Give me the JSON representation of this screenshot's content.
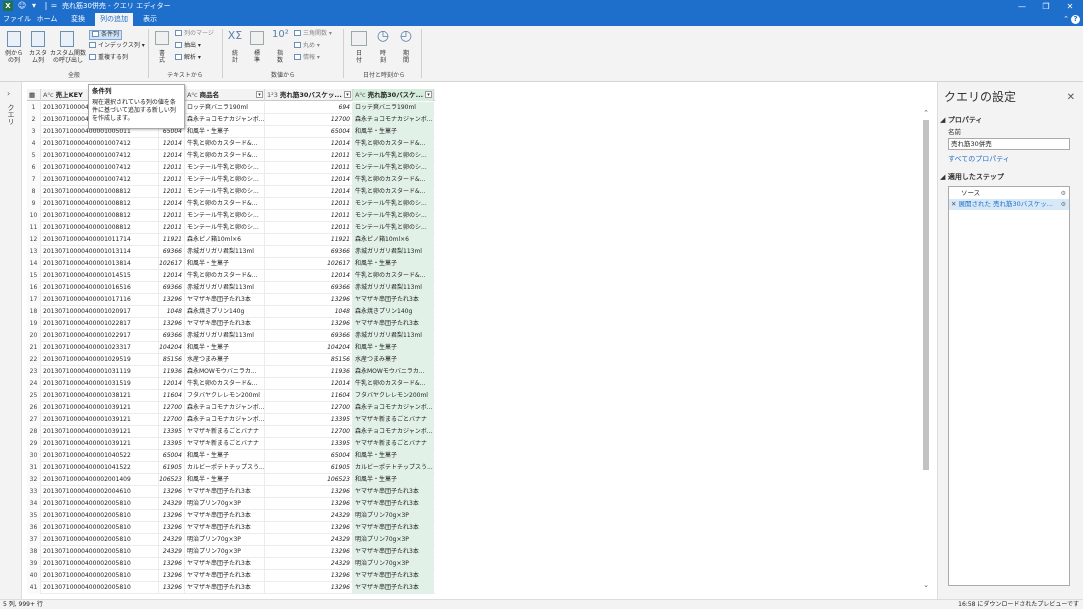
{
  "titlebar": {
    "app_letter": "X",
    "title": "売れ筋30併売 - クエリ エディター",
    "controls": {
      "minimize": "—",
      "maximize": "❐",
      "close": "✕"
    }
  },
  "tabs": [
    {
      "label": "ファイル"
    },
    {
      "label": "ホーム"
    },
    {
      "label": "変換"
    },
    {
      "label": "列の追加"
    },
    {
      "label": "表示"
    }
  ],
  "ribbon": {
    "btn_example": [
      "例から",
      "の列"
    ],
    "btn_custom": [
      "カスタ",
      "ム列"
    ],
    "btn_invoke": [
      "カスタム関数",
      "の呼び出し"
    ],
    "btn_conditional": "条件列",
    "btn_index": "インデックス列",
    "btn_duplicate": "重複する列",
    "group_general": "全般",
    "btn_format": [
      "書",
      "式"
    ],
    "btn_merge": "列のマージ",
    "btn_extract": "抽出",
    "btn_parse": "解析",
    "group_text": "テキストから",
    "btn_stats": [
      "統",
      "計"
    ],
    "btn_standard": [
      "標",
      "準"
    ],
    "btn_scientific": [
      "指",
      "数"
    ],
    "btn_trig": "三角関数",
    "btn_round": "丸め",
    "btn_info": "情報",
    "group_number": "数値から",
    "btn_date": [
      "日",
      "付"
    ],
    "btn_time": [
      "時",
      "刻"
    ],
    "btn_duration": [
      "期",
      "間"
    ],
    "group_datetime": "日付と時刻から"
  },
  "leftpanel": {
    "label": "クエリ"
  },
  "tooltip": {
    "title": "条件列",
    "body": "現在選択されている列の値を条件に基づいて追加する新しい列を作成します。"
  },
  "grid": {
    "headers": [
      {
        "type": "A⁰c",
        "label": "売上KEY"
      },
      {
        "type": "",
        "label": ""
      },
      {
        "type": "A⁰c",
        "label": "商品名"
      },
      {
        "type": "1²3",
        "label": "売れ筋30バスケッ..."
      },
      {
        "type": "A⁰c",
        "label": "売れ筋30バスケ..."
      }
    ],
    "rows": [
      [
        "1",
        "20130710000400001000",
        "694",
        "ロッテ爽バニラ190ml",
        "694",
        "ロッテ爽バニラ190ml"
      ],
      [
        "2",
        "20130710000400001000",
        "12700",
        "森永チョコモナカジャンボ...",
        "12700",
        "森永チョコモナカジャンボ..."
      ],
      [
        "3",
        "20130710000400001005011",
        "65004",
        "和風半・生菓子",
        "65004",
        "和風半・生菓子"
      ],
      [
        "4",
        "20130710000400001007412",
        "12014",
        "牛乳と卵のカスタード&...",
        "12014",
        "牛乳と卵のカスタード&..."
      ],
      [
        "5",
        "20130710000400001007412",
        "12014",
        "牛乳と卵のカスタード&...",
        "12011",
        "モンテール牛乳と卵のシ..."
      ],
      [
        "6",
        "20130710000400001007412",
        "12011",
        "モンテール牛乳と卵のシ...",
        "12011",
        "モンテール牛乳と卵のシ..."
      ],
      [
        "7",
        "20130710000400001007412",
        "12011",
        "モンテール牛乳と卵のシ...",
        "12014",
        "牛乳と卵のカスタード&..."
      ],
      [
        "8",
        "20130710000400001008812",
        "12011",
        "モンテール牛乳と卵のシ...",
        "12014",
        "牛乳と卵のカスタード&..."
      ],
      [
        "9",
        "20130710000400001008812",
        "12014",
        "牛乳と卵のカスタード&...",
        "12011",
        "モンテール牛乳と卵のシ..."
      ],
      [
        "10",
        "20130710000400001008812",
        "12011",
        "モンテール牛乳と卵のシ...",
        "12011",
        "モンテール牛乳と卵のシ..."
      ],
      [
        "11",
        "20130710000400001008812",
        "12011",
        "モンテール牛乳と卵のシ...",
        "12011",
        "モンテール牛乳と卵のシ..."
      ],
      [
        "12",
        "20130710000400001011714",
        "11921",
        "森永ピノ箱10ml×6",
        "11921",
        "森永ピノ箱10ml×6"
      ],
      [
        "13",
        "20130710000400001013114",
        "69366",
        "赤城ガリガリ君梨113ml",
        "69366",
        "赤城ガリガリ君梨113ml"
      ],
      [
        "14",
        "20130710000400001013814",
        "102617",
        "和風半・生菓子",
        "102617",
        "和風半・生菓子"
      ],
      [
        "15",
        "20130710000400001014515",
        "12014",
        "牛乳と卵のカスタード&...",
        "12014",
        "牛乳と卵のカスタード&..."
      ],
      [
        "16",
        "20130710000400001016516",
        "69366",
        "赤城ガリガリ君梨113ml",
        "69366",
        "赤城ガリガリ君梨113ml"
      ],
      [
        "17",
        "20130710000400001017116",
        "13296",
        "ヤマザキ串団子たれ3本",
        "13296",
        "ヤマザキ串団子たれ3本"
      ],
      [
        "18",
        "20130710000400001020917",
        "1048",
        "森永焼きプリン140g",
        "1048",
        "森永焼きプリン140g"
      ],
      [
        "19",
        "20130710000400001022817",
        "13296",
        "ヤマザキ串団子たれ3本",
        "13296",
        "ヤマザキ串団子たれ3本"
      ],
      [
        "20",
        "20130710000400001022917",
        "69366",
        "赤城ガリガリ君梨113ml",
        "69366",
        "赤城ガリガリ君梨113ml"
      ],
      [
        "21",
        "20130710000400001023317",
        "104204",
        "和風半・生菓子",
        "104204",
        "和風半・生菓子"
      ],
      [
        "22",
        "20130710000400001029519",
        "85156",
        "水産つまみ菓子",
        "85156",
        "水産つまみ菓子"
      ],
      [
        "23",
        "20130710000400001031119",
        "11936",
        "森永MOWモウバニラカ...",
        "11936",
        "森永MOWモウバニラカ..."
      ],
      [
        "24",
        "20130710000400001031519",
        "12014",
        "牛乳と卵のカスタード&...",
        "12014",
        "牛乳と卵のカスタード&..."
      ],
      [
        "25",
        "20130710000400001038121",
        "11604",
        "フタバヤクレレモン200ml",
        "11604",
        "フタバヤクレレモン200ml"
      ],
      [
        "26",
        "20130710000400001039121",
        "12700",
        "森永チョコモナカジャンボ...",
        "12700",
        "森永チョコモナカジャンボ..."
      ],
      [
        "27",
        "20130710000400001039121",
        "12700",
        "森永チョコモナカジャンボ...",
        "13395",
        "ヤマザキ新まるごとバナナ"
      ],
      [
        "28",
        "20130710000400001039121",
        "13395",
        "ヤマザキ新まるごとバナナ",
        "12700",
        "森永チョコモナカジャンボ..."
      ],
      [
        "29",
        "20130710000400001039121",
        "13395",
        "ヤマザキ新まるごとバナナ",
        "13395",
        "ヤマザキ新まるごとバナナ"
      ],
      [
        "30",
        "20130710000400001040522",
        "65004",
        "和風半・生菓子",
        "65004",
        "和風半・生菓子"
      ],
      [
        "31",
        "20130710000400001041522",
        "61905",
        "カルビーポテトチップスう...",
        "61905",
        "カルビーポテトチップスう..."
      ],
      [
        "32",
        "20130710000400002001409",
        "106523",
        "和風半・生菓子",
        "106523",
        "和風半・生菓子"
      ],
      [
        "33",
        "20130710000400002004610",
        "13296",
        "ヤマザキ串団子たれ3本",
        "13296",
        "ヤマザキ串団子たれ3本"
      ],
      [
        "34",
        "20130710000400002005810",
        "24329",
        "明治プリン70g×3P",
        "13296",
        "ヤマザキ串団子たれ3本"
      ],
      [
        "35",
        "20130710000400002005810",
        "13296",
        "ヤマザキ串団子たれ3本",
        "24329",
        "明治プリン70g×3P"
      ],
      [
        "36",
        "20130710000400002005810",
        "13296",
        "ヤマザキ串団子たれ3本",
        "13296",
        "ヤマザキ串団子たれ3本"
      ],
      [
        "37",
        "20130710000400002005810",
        "24329",
        "明治プリン70g×3P",
        "24329",
        "明治プリン70g×3P"
      ],
      [
        "38",
        "20130710000400002005810",
        "24329",
        "明治プリン70g×3P",
        "13296",
        "ヤマザキ串団子たれ3本"
      ],
      [
        "39",
        "20130710000400002005810",
        "13296",
        "ヤマザキ串団子たれ3本",
        "24329",
        "明治プリン70g×3P"
      ],
      [
        "40",
        "20130710000400002005810",
        "13296",
        "ヤマザキ串団子たれ3本",
        "13296",
        "ヤマザキ串団子たれ3本"
      ],
      [
        "41",
        "20130710000400002005810",
        "13296",
        "ヤマザキ串団子たれ3本",
        "13296",
        "ヤマザキ串団子たれ3本"
      ],
      [
        "42",
        "20130710000400002005810",
        "13296",
        "ヤマザキ串団子たれ3本",
        "13296",
        "ヤマザキ串団子たれ3本"
      ]
    ]
  },
  "query_settings": {
    "title": "クエリの設定",
    "properties_label": "プロパティ",
    "name_label": "名前",
    "name_value": "売れ筋30併売",
    "all_properties": "すべてのプロパティ",
    "applied_steps_label": "適用したステップ",
    "steps": [
      {
        "label": "ソース"
      },
      {
        "label": "展開された 売れ筋30バスケッ..."
      }
    ]
  },
  "status": {
    "left": "5 列, 999+ 行",
    "right": "16:58 にダウンロードされたプレビューです"
  },
  "colors": {
    "titlebar": "#1e6fcc",
    "selected_column": "#e2f1e7",
    "link": "#1e6fcc"
  }
}
